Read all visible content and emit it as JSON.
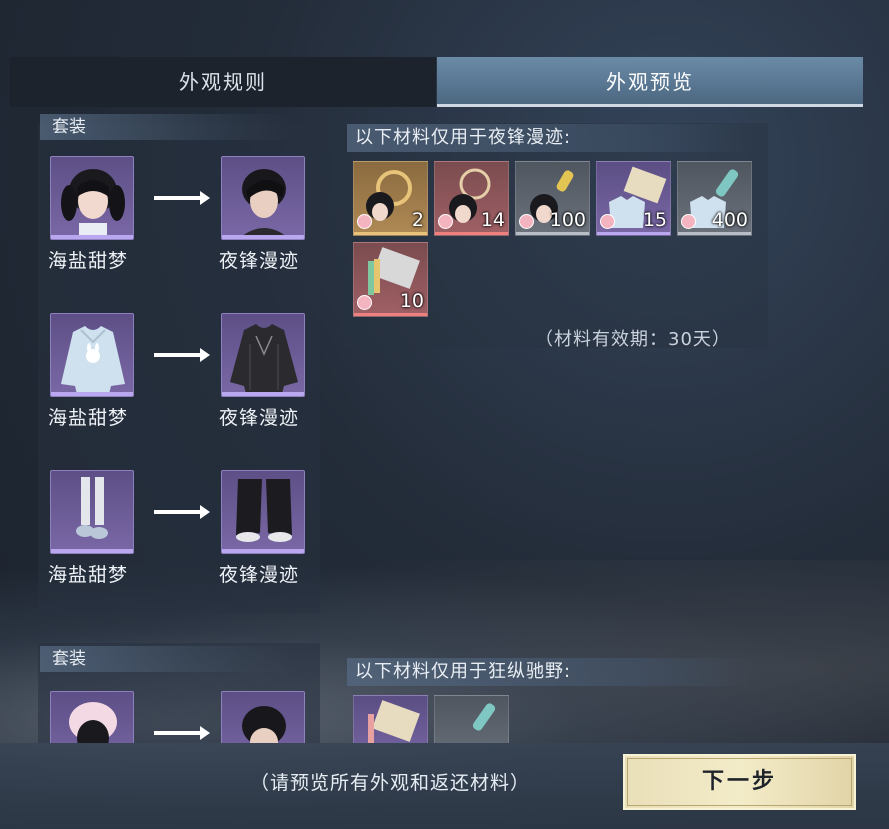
{
  "tabs": [
    {
      "label": "外观规则",
      "active": false
    },
    {
      "label": "外观预览",
      "active": true
    }
  ],
  "sections": [
    {
      "header": "套装",
      "outfits": [
        {
          "from_name": "海盐甜梦",
          "to_name": "夜锋漫迹",
          "from_icon": "hairstyle-icon",
          "to_icon": "hairstyle-icon"
        },
        {
          "from_name": "海盐甜梦",
          "to_name": "夜锋漫迹",
          "from_icon": "top-clothing-icon",
          "to_icon": "top-clothing-icon"
        },
        {
          "from_name": "海盐甜梦",
          "to_name": "夜锋漫迹",
          "from_icon": "pants-shoes-icon",
          "to_icon": "pants-shoes-icon"
        }
      ],
      "materials_header": "以下材料仅用于夜锋漫迹:",
      "materials": [
        {
          "qty": "2",
          "rarity": "gold",
          "icon": "hair-accessory-material-icon"
        },
        {
          "qty": "14",
          "rarity": "red",
          "icon": "hair-accessory-material-icon"
        },
        {
          "qty": "100",
          "rarity": "gray",
          "icon": "hair-dye-material-icon"
        },
        {
          "qty": "15",
          "rarity": "purple",
          "icon": "cloth-material-icon"
        },
        {
          "qty": "400",
          "rarity": "gray",
          "icon": "dye-material-icon"
        },
        {
          "qty": "10",
          "rarity": "red",
          "icon": "cloth-material-icon"
        }
      ],
      "validity": "（材料有效期：30天）"
    },
    {
      "header": "套装",
      "materials_header": "以下材料仅用于狂纵驰野:"
    }
  ],
  "footer": {
    "note": "（请预览所有外观和返还材料）",
    "next_button": "下一步"
  },
  "colors": {
    "active_tab": "#5a7893",
    "button": "#f0e8c4",
    "card_purple": "#7a68a6"
  }
}
